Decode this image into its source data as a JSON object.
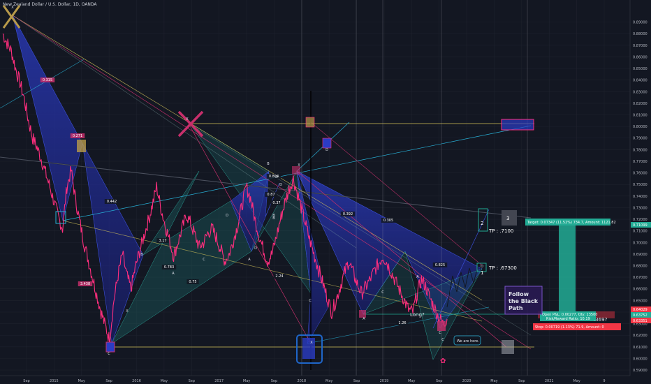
{
  "header": {
    "title": "New Zealand Dollar / U.S. Dollar, 1D, OANDA"
  },
  "chart_data": {
    "type": "line",
    "ylim": [
      0.59,
      0.9
    ],
    "grid": true,
    "y_ticks": [
      "0.89000",
      "0.88000",
      "0.87000",
      "0.86000",
      "0.85000",
      "0.84000",
      "0.83000",
      "0.82000",
      "0.81000",
      "0.80000",
      "0.79000",
      "0.78000",
      "0.77000",
      "0.76000",
      "0.75000",
      "0.74000",
      "0.73000",
      "0.72000",
      "0.71000",
      "0.70000",
      "0.69000",
      "0.68000",
      "0.67000",
      "0.66000",
      "0.65000",
      "0.64000",
      "0.63000",
      "0.62000",
      "0.61000",
      "0.60000",
      "0.59000"
    ],
    "x_ticks": [
      "Sep",
      "2015",
      "May",
      "Sep",
      "2016",
      "May",
      "Sep",
      "2017",
      "May",
      "Sep",
      "2018",
      "May",
      "Sep",
      "2019",
      "May",
      "Sep",
      "2020",
      "May",
      "Sep",
      "2021",
      "May",
      "9"
    ],
    "series": [
      {
        "values": [
          0.88,
          0.872,
          0.865,
          0.85,
          0.838,
          0.824,
          0.805,
          0.79,
          0.782,
          0.772,
          0.76,
          0.748,
          0.735,
          0.722,
          0.712,
          0.748,
          0.762,
          0.738,
          0.718,
          0.7,
          0.685,
          0.67,
          0.655,
          0.64,
          0.628,
          0.616,
          0.65,
          0.672,
          0.69,
          0.672,
          0.66,
          0.678,
          0.692,
          0.705,
          0.718,
          0.732,
          0.748,
          0.73,
          0.715,
          0.702,
          0.688,
          0.7,
          0.712,
          0.724,
          0.716,
          0.706,
          0.696,
          0.7,
          0.708,
          0.712,
          0.704,
          0.694,
          0.684,
          0.69,
          0.702,
          0.715,
          0.732,
          0.748,
          0.738,
          0.72,
          0.706,
          0.694,
          0.684,
          0.69,
          0.704,
          0.72,
          0.734,
          0.746,
          0.755,
          0.742,
          0.728,
          0.714,
          0.7,
          0.688,
          0.676,
          0.664,
          0.652,
          0.64,
          0.65,
          0.662,
          0.674,
          0.684,
          0.674,
          0.664,
          0.656,
          0.662,
          0.668,
          0.676,
          0.682,
          0.688,
          0.682,
          0.674,
          0.666,
          0.658,
          0.65,
          0.642,
          0.64,
          0.656,
          0.668,
          0.662,
          0.652,
          0.644,
          0.636,
          0.63,
          0.634
        ]
      }
    ],
    "price_labels": [
      {
        "text": "0.71099",
        "color": "#22ab94"
      },
      {
        "text": "0.64029",
        "color": "#f23645"
      },
      {
        "text": "0.63752",
        "color": "#22ab94"
      },
      {
        "text": "0.63351",
        "color": "#f23645"
      }
    ],
    "pattern_labels": [
      "0.315",
      "0.271",
      "0.442",
      "3.438",
      "3.17",
      "0.783",
      "0.75",
      "0.804",
      "0.87",
      "0.37",
      "2.24",
      "0.392",
      "0.305",
      "0.825",
      "1.26"
    ],
    "point_labels": [
      "X",
      "C",
      "A",
      "B",
      "B",
      "C",
      "D",
      "X",
      "A",
      "B",
      "C",
      "D",
      "D",
      "D",
      "B",
      "X",
      "X",
      "A",
      "C",
      "X",
      "A",
      "D",
      "C",
      "D",
      "C"
    ],
    "targets": [
      {
        "num": "1",
        "text": "TP : .67300"
      },
      {
        "num": "2",
        "text": "TP : .7100"
      },
      {
        "num": "3",
        "text": ""
      }
    ],
    "target_box": "Target: 0.07347 (11.52%) 734.7, Amount: 1121.82",
    "stop_box": "Stop: 0.00719 (1.13%) 71.9, Amount: 0",
    "position_box": [
      "Open P&L: 0.00277, Qty: 13500",
      "Risk/Reward Ratio: 10.19"
    ],
    "notes": {
      "follow": [
        "Follow",
        "the Black",
        "Path"
      ],
      "long": "Long?",
      "we_are_here": "We are here.",
      "b369": ".369?"
    }
  },
  "colors": {
    "background": "#131722",
    "price_line": "#ff2e7e",
    "pattern_fill": "#1f2d8c",
    "target_green": "#22ab94",
    "stop_red": "#f23645",
    "yellow_line": "#d4c35a"
  }
}
